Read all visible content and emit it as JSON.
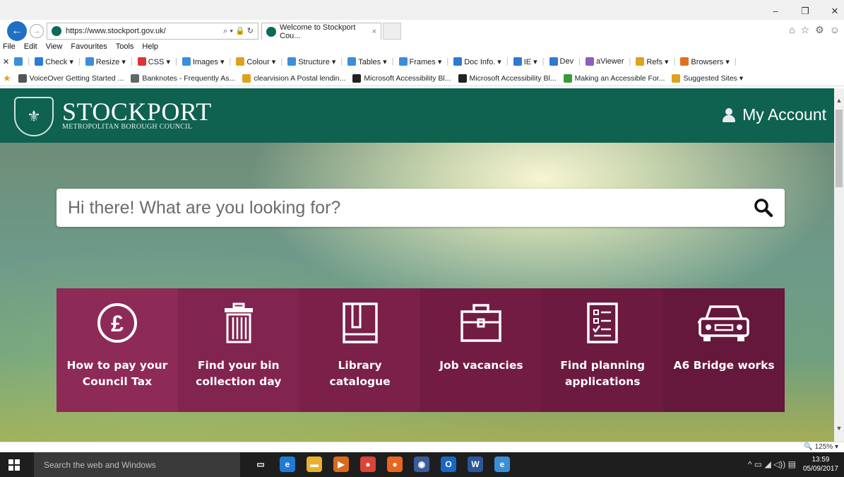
{
  "browser": {
    "url": "https://www.stockport.gov.uk/",
    "address_tools": "⌕ ▾ 🔒 ↻",
    "tab_title": "Welcome to Stockport Cou...",
    "tab_close": "×",
    "window_controls": [
      "–",
      "❐",
      "✕"
    ],
    "chrome_icons": [
      "⌂",
      "☆",
      "⚙",
      "☺"
    ],
    "menu": [
      "File",
      "Edit",
      "View",
      "Favourites",
      "Tools",
      "Help"
    ],
    "devbar": [
      {
        "label": "Check ▾",
        "icon": "check-icon",
        "color": "#2b7bd6"
      },
      {
        "label": "Resize ▾",
        "icon": "resize-icon",
        "color": "#3a8fd8"
      },
      {
        "label": "CSS ▾",
        "icon": "css-icon",
        "color": "#d33"
      },
      {
        "label": "Images ▾",
        "icon": "images-icon",
        "color": "#3a8fd8"
      },
      {
        "label": "Colour ▾",
        "icon": "colour-icon",
        "color": "#e0a020"
      },
      {
        "label": "Structure ▾",
        "icon": "structure-icon",
        "color": "#3a8fd8"
      },
      {
        "label": "Tables ▾",
        "icon": "tables-icon",
        "color": "#3a8fd8"
      },
      {
        "label": "Frames ▾",
        "icon": "frames-icon",
        "color": "#3a8fd8"
      },
      {
        "label": "Doc Info. ▾",
        "icon": "doc-info-icon",
        "color": "#2b7bd6"
      },
      {
        "label": "IE ▾",
        "icon": "ie-icon",
        "color": "#2b7bd6"
      },
      {
        "label": "Dev",
        "icon": "dev-icon",
        "color": "#2b7bd6"
      },
      {
        "label": "aViewer",
        "icon": "aviewer-icon",
        "color": "#8a5fc0"
      },
      {
        "label": "Refs ▾",
        "icon": "refs-icon",
        "color": "#e0a020"
      },
      {
        "label": "Browsers ▾",
        "icon": "browsers-icon",
        "color": "#e07020"
      }
    ],
    "favourites": [
      {
        "label": "VoiceOver Getting Started ...",
        "color": "#555"
      },
      {
        "label": "Banknotes - Frequently As...",
        "color": "#666"
      },
      {
        "label": "clearvision A Postal lendin...",
        "color": "#e0a020"
      },
      {
        "label": "Microsoft Accessibility Bl...",
        "color": "#222"
      },
      {
        "label": "Microsoft Accessibility Bl...",
        "color": "#222"
      },
      {
        "label": "Making an Accessible For...",
        "color": "#3a9a3a"
      },
      {
        "label": "Suggested Sites ▾",
        "color": "#e0a020"
      }
    ],
    "zoom": "🔍 125% ▾"
  },
  "site": {
    "brand_name": "STOCKPORT",
    "brand_sub": "METROPOLITAN BOROUGH COUNCIL",
    "account_label": "My Account",
    "search_placeholder": "Hi there! What are you looking for?",
    "tiles": [
      {
        "label": "How to pay your Council Tax",
        "icon": "pound-icon",
        "color": "#8e2a57"
      },
      {
        "label": "Find your bin collection day",
        "icon": "bin-icon",
        "color": "#822450"
      },
      {
        "label": "Library catalogue",
        "icon": "book-icon",
        "color": "#7a2049"
      },
      {
        "label": "Job vacancies",
        "icon": "briefcase-icon",
        "color": "#721c44"
      },
      {
        "label": "Find planning applications",
        "icon": "checklist-icon",
        "color": "#6c1a40"
      },
      {
        "label": "A6 Bridge works",
        "icon": "car-icon",
        "color": "#66173c"
      }
    ]
  },
  "taskbar": {
    "search_placeholder": "Search the web and Windows",
    "apps": [
      {
        "name": "task-view-icon",
        "glyph": "▭",
        "color": "transparent"
      },
      {
        "name": "edge-icon",
        "glyph": "e",
        "color": "#1f7bd6"
      },
      {
        "name": "file-explorer-icon",
        "glyph": "▬",
        "color": "#e7b12b"
      },
      {
        "name": "media-player-icon",
        "glyph": "▶",
        "color": "#d86a1e"
      },
      {
        "name": "chrome-icon",
        "glyph": "●",
        "color": "#db4437"
      },
      {
        "name": "firefox-icon",
        "glyph": "●",
        "color": "#e8661f"
      },
      {
        "name": "app-icon",
        "glyph": "◉",
        "color": "#3b5b9a"
      },
      {
        "name": "outlook-icon",
        "glyph": "O",
        "color": "#1769c4"
      },
      {
        "name": "word-icon",
        "glyph": "W",
        "color": "#2b579a"
      },
      {
        "name": "ie-icon",
        "glyph": "e",
        "color": "#3a8fd8"
      }
    ],
    "tray_icons": "^ ▭ ◢ ◁)) ▤",
    "time": "13:59",
    "date": "05/09/2017"
  }
}
